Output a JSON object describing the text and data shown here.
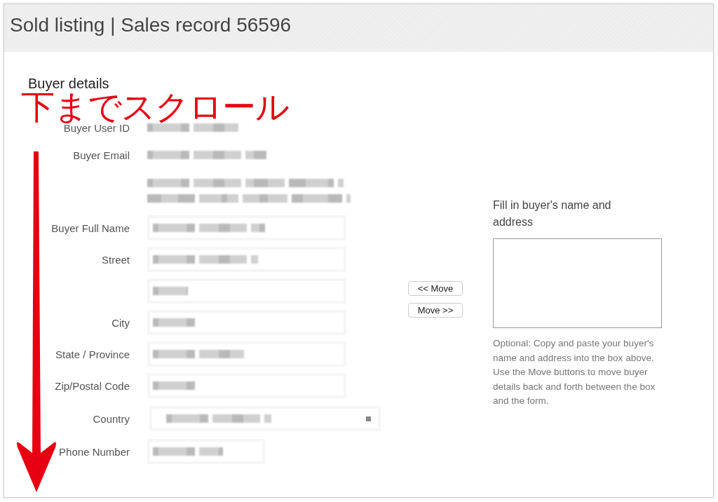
{
  "window": {
    "title": "Sold listing | Sales record 56596"
  },
  "section": {
    "heading": "Buyer details"
  },
  "fields": [
    {
      "label": "Buyer User ID",
      "kind": "text"
    },
    {
      "label": "Buyer Email",
      "kind": "text"
    },
    {
      "kind": "note"
    },
    {
      "label": "Buyer Full Name",
      "kind": "input"
    },
    {
      "label": "Street",
      "kind": "input"
    },
    {
      "kind": "input"
    },
    {
      "label": "City",
      "kind": "input"
    },
    {
      "label": "State / Province",
      "kind": "input"
    },
    {
      "label": "Zip/Postal Code",
      "kind": "input"
    },
    {
      "label": "Country",
      "kind": "select"
    },
    {
      "label": "Phone Number",
      "kind": "short_input"
    }
  ],
  "move_buttons": [
    "<< Move",
    "Move >>"
  ],
  "paste_box": {
    "heading": "Fill in buyer's name and address",
    "help": "Optional: Copy and paste your buyer's name and address into the box above. Use the Move buttons to move buyer details back and forth between the box and the form."
  },
  "annotation": {
    "text": "下までスクロール"
  }
}
